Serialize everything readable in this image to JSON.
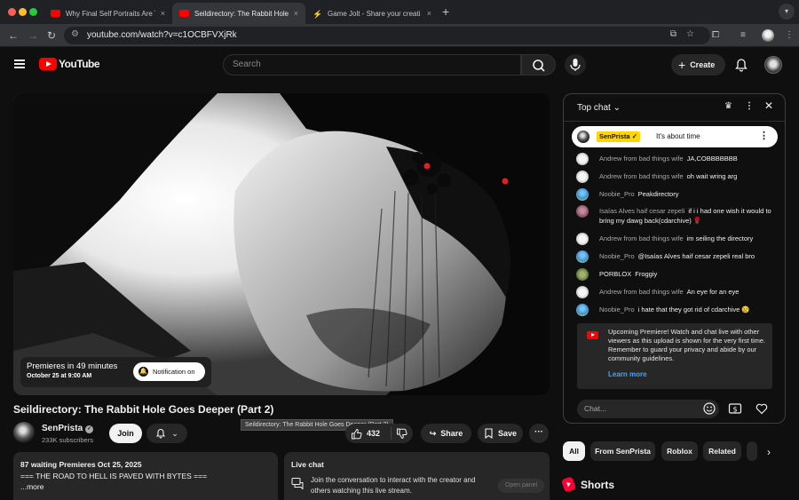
{
  "browser": {
    "tabs": [
      {
        "title": "Why Final Self Portraits Are T",
        "close": "×"
      },
      {
        "title": "Seildirectory: The Rabbit Hole",
        "close": "×"
      },
      {
        "title": "Game Jolt - Share your creati",
        "close": "×"
      }
    ],
    "new_tab": "+",
    "url": "youtube.com/watch?v=c1OCBFVXjRk"
  },
  "header": {
    "logo_text": "YouTube",
    "search_placeholder": "Search",
    "create_label": "Create"
  },
  "video": {
    "premiere_title": "Premieres in 49 minutes",
    "premiere_date": "October 25 at 9:00 AM",
    "notify_label": "Notification on",
    "title": "Seildirectory: The Rabbit Hole Goes Deeper (Part 2)",
    "tooltip": "Seildirectory: The Rabbit Hole Goes Deeper (Part 2)"
  },
  "channel": {
    "name": "SenPrista",
    "subscribers": "233K subscribers",
    "join_label": "Join"
  },
  "actions": {
    "like_count": "432",
    "share_label": "Share",
    "save_label": "Save",
    "more": "···"
  },
  "description": {
    "meta": "87 waiting  Premieres Oct 25, 2025",
    "line": "=== THE ROAD TO HELL IS PAVED WITH BYTES ===",
    "more": "...more"
  },
  "live_chat_box": {
    "title": "Live chat",
    "text": "Join the conversation to interact with the creator and others watching this live stream.",
    "open_panel": "Open panel"
  },
  "chat": {
    "header": "Top chat",
    "pinned": {
      "author": "SenPrista",
      "message": "It's about time"
    },
    "messages": [
      {
        "author": "Andrew from bad things wife",
        "text": "JA,COBBBBBBB",
        "avatar": "white"
      },
      {
        "author": "Andrew from bad things wife",
        "text": "oh wait wring arg",
        "avatar": "white"
      },
      {
        "author": "Noobie_Pro",
        "text": "Peakdirectory",
        "avatar": "blue"
      },
      {
        "author": "Isaías Alves haif cesar zepeli",
        "text": "if i i had one wish it would to bring my dawg back(cdarchive) 🌹",
        "avatar": "pink"
      },
      {
        "author": "Andrew from bad things wife",
        "text": "im seiling the directory",
        "avatar": "white"
      },
      {
        "author": "Noobie_Pro",
        "text": "@Isaías Alves haif cesar zepeli real bro",
        "avatar": "blue"
      },
      {
        "author": "PORBLOX",
        "text": "Froggiy",
        "avatar": "green"
      },
      {
        "author": "Andrew from bad things wife",
        "text": "An eye for an eye",
        "avatar": "white"
      },
      {
        "author": "Noobie_Pro",
        "text": "i hate that they got rid of cdarchive 😢",
        "avatar": "blue"
      }
    ],
    "upcoming_text": "Upcoming Premiere! Watch and chat live with other viewers as this upload is shown for the very first time. Remember to guard your privacy and abide by our community guidelines.",
    "learn_more": "Learn more",
    "input_placeholder": "Chat..."
  },
  "chips": [
    "All",
    "From SenPrista",
    "Roblox",
    "Related"
  ],
  "shorts_label": "Shorts",
  "colors": {
    "youtube_red": "#ff0000",
    "highlight": "#ffd600",
    "link": "#3ea6ff"
  }
}
